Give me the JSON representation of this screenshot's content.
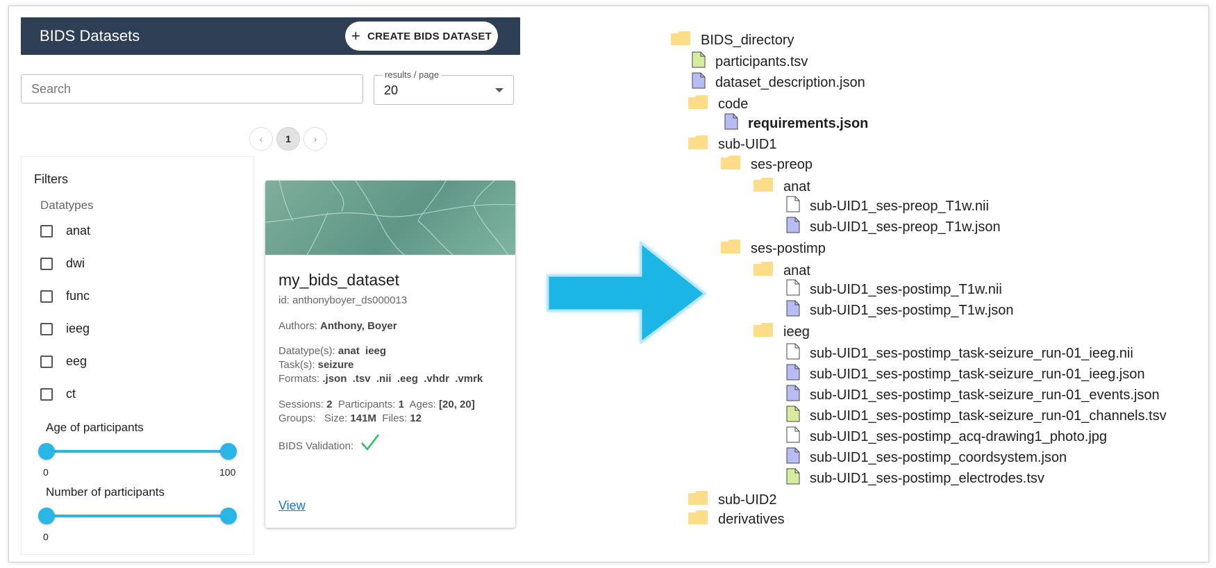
{
  "app": {
    "title": "BIDS Datasets",
    "create_button": "CREATE BIDS DATASET",
    "search_placeholder": "Search",
    "results_per_page_label": "results / page",
    "results_per_page_value": "20",
    "pagination": {
      "prev": "‹",
      "current": "1",
      "next": "›"
    }
  },
  "filters": {
    "title": "Filters",
    "datatypes_title": "Datatypes",
    "datatypes": [
      "anat",
      "dwi",
      "func",
      "ieeg",
      "eeg",
      "ct"
    ],
    "age": {
      "label": "Age of participants",
      "min": "0",
      "max": "100"
    },
    "participants": {
      "label": "Number of participants",
      "min": "0"
    }
  },
  "dataset_card": {
    "name": "my_bids_dataset",
    "id": "id: anthonyboyer_ds000013",
    "authors_label": "Authors:",
    "authors": "Anthony, Boyer",
    "datatypes_label": "Datatype(s):",
    "datatypes": "anat  ieeg",
    "tasks_label": "Task(s):",
    "tasks": "seizure",
    "formats_label": "Formats:",
    "formats": ".json  .tsv  .nii  .eeg  .vhdr  .vmrk",
    "sessions_label": "Sessions:",
    "sessions": "2",
    "participants_label": "Participants:",
    "participants": "1",
    "ages_label": "Ages:",
    "ages": "[20, 20]",
    "groups_label": "Groups:",
    "size_label": "Size:",
    "size": "141M",
    "files_label": "Files:",
    "files": "12",
    "validation_label": "BIDS Validation:",
    "view_link": "View"
  },
  "colors": {
    "appbar": "#2e3e55",
    "accent": "#29b6e6",
    "arrow": "#1fb6e6",
    "folder": "#fddc8a",
    "json_file": "#b8bcf5",
    "tsv_file": "#d8eca0"
  },
  "tree": [
    {
      "name": "BIDS_directory",
      "type": "folder",
      "bold": false
    },
    {
      "name": "participants.tsv",
      "type": "tsv"
    },
    {
      "name": "dataset_description.json",
      "type": "json"
    },
    {
      "name": "code",
      "type": "folder"
    },
    {
      "name": "requirements.json",
      "type": "json",
      "bold": true
    },
    {
      "name": "sub-UID1",
      "type": "folder"
    },
    {
      "name": "ses-preop",
      "type": "folder"
    },
    {
      "name": "anat",
      "type": "folder"
    },
    {
      "name": "sub-UID1_ses-preop_T1w.nii",
      "type": "plain"
    },
    {
      "name": "sub-UID1_ses-preop_T1w.json",
      "type": "json"
    },
    {
      "name": "ses-postimp",
      "type": "folder"
    },
    {
      "name": "anat",
      "type": "folder"
    },
    {
      "name": "sub-UID1_ses-postimp_T1w.nii",
      "type": "plain"
    },
    {
      "name": "sub-UID1_ses-postimp_T1w.json",
      "type": "json"
    },
    {
      "name": "ieeg",
      "type": "folder"
    },
    {
      "name": "sub-UID1_ses-postimp_task-seizure_run-01_ieeg.nii",
      "type": "plain"
    },
    {
      "name": "sub-UID1_ses-postimp_task-seizure_run-01_ieeg.json",
      "type": "json"
    },
    {
      "name": "sub-UID1_ses-postimp_task-seizure_run-01_events.json",
      "type": "json"
    },
    {
      "name": "sub-UID1_ses-postimp_task-seizure_run-01_channels.tsv",
      "type": "tsv"
    },
    {
      "name": "sub-UID1_ses-postimp_acq-drawing1_photo.jpg",
      "type": "plain"
    },
    {
      "name": "sub-UID1_ses-postimp_coordsystem.json",
      "type": "json"
    },
    {
      "name": "sub-UID1_ses-postimp_electrodes.tsv",
      "type": "tsv"
    },
    {
      "name": "sub-UID2",
      "type": "folder"
    },
    {
      "name": "derivatives",
      "type": "folder"
    }
  ]
}
